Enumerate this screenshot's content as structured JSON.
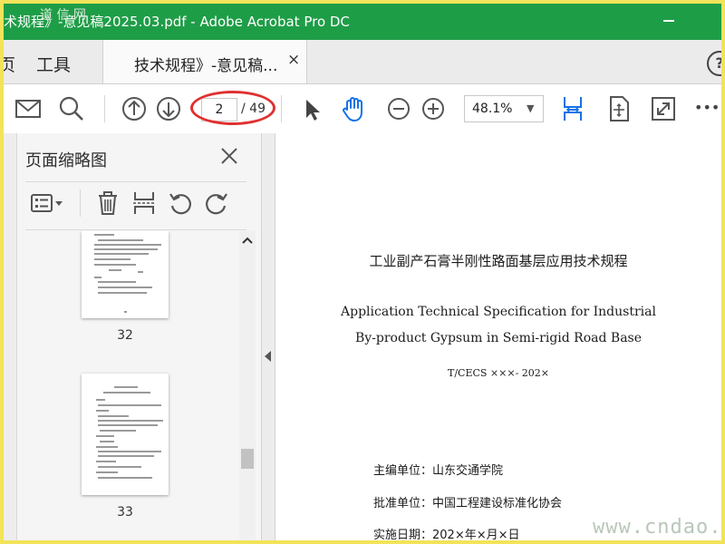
{
  "window": {
    "title": "术规程》-意见稿2025.03.pdf - Adobe Acrobat Pro DC"
  },
  "tabs": {
    "home_partial": "页",
    "tools": "工具",
    "doc_tab": "技术规程》-意见稿...",
    "close_glyph": "×",
    "help_glyph": "?"
  },
  "toolbar": {
    "page_current": "2",
    "page_total": "/ 49",
    "zoom": "48.1%",
    "zoom_arrow": "▼",
    "more": "•••"
  },
  "panel": {
    "title": "页面缩略图",
    "thumbnails": [
      {
        "page": "32"
      },
      {
        "page": "33"
      }
    ]
  },
  "document": {
    "title_cn": "工业副产石膏半刚性路面基层应用技术规程",
    "title_en_1": "Application Technical Specification for Industrial",
    "title_en_2": "By-product Gypsum in Semi-rigid Road Base",
    "code": "T/CECS ×××- 202×",
    "editor": "主编单位：山东交通学院",
    "approver": "批准单位：中国工程建设标准化协会",
    "date": "实施日期：202×年×月×日"
  },
  "watermark": {
    "bottom_right": "www.cndao.com",
    "top_left": "道 信 网"
  },
  "colors": {
    "title_bar": "#1e9d47",
    "accent_blue": "#1473e6",
    "annotation_red": "#e03030",
    "outer_frame": "#f2e35a"
  }
}
